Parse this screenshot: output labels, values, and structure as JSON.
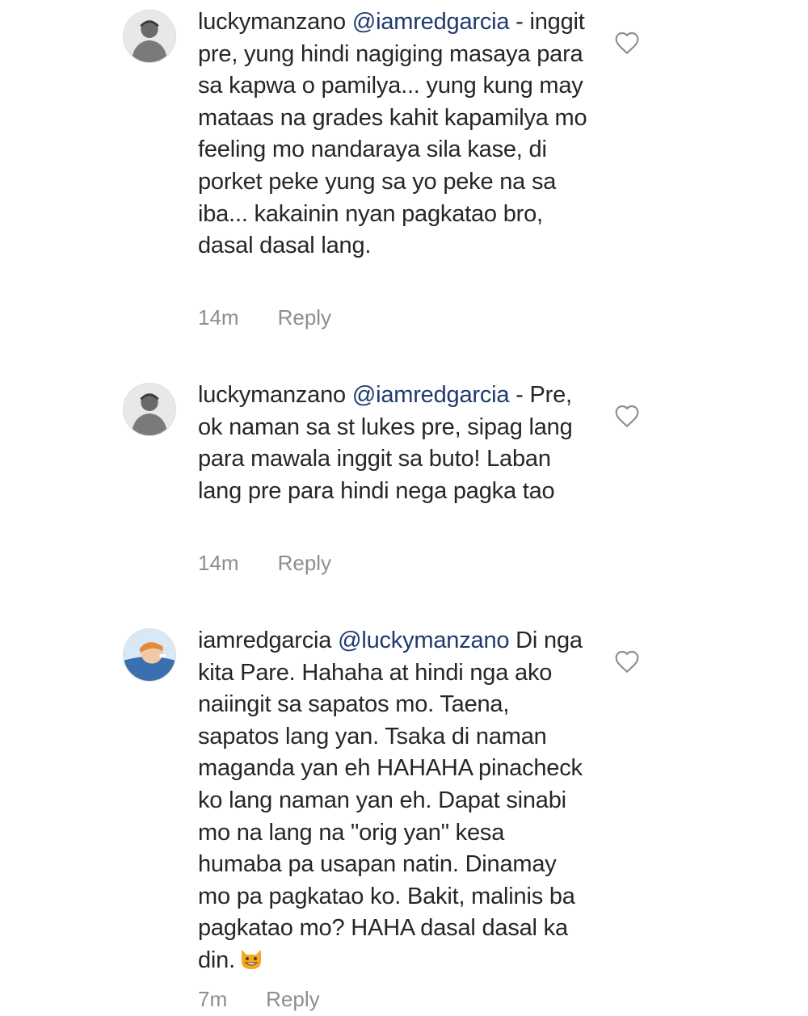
{
  "comments": [
    {
      "username": "luckymanzano",
      "mention": "@iamredgarcia",
      "text": " - inggit pre, yung hindi nagiging masaya para sa kapwa o pamilya... yung kung may mataas na grades kahit kapamilya mo feeling mo nandaraya sila kase, di porket peke yung sa yo peke na sa iba... kakainin nyan pagkatao bro, dasal dasal lang.",
      "time": "14m",
      "reply_label": "Reply",
      "avatar_icon": "user-avatar-icon"
    },
    {
      "username": "luckymanzano",
      "mention": "@iamredgarcia",
      "text": " - Pre, ok naman sa st lukes pre, sipag lang para mawala inggit sa buto! Laban lang pre para hindi nega pagka tao",
      "time": "14m",
      "reply_label": "Reply",
      "avatar_icon": "user-avatar-icon"
    },
    {
      "username": "iamredgarcia",
      "mention": "@luckymanzano",
      "text": " Di nga kita Pare. Hahaha at hindi nga ako naiingit sa sapatos mo. Taena, sapatos lang yan. Tsaka di naman maganda yan eh HAHAHA pinacheck ko lang naman yan eh. Dapat sinabi mo na lang na \"orig yan\" kesa humaba pa usapan natin. Dinamay mo pa pagkatao ko. Bakit, malinis ba pagkatao mo? HAHA dasal dasal ka din.",
      "time": "7m",
      "reply_label": "Reply",
      "avatar_icon": "user-avatar-icon",
      "emoji_icon": "grinning-cat-emoji-icon"
    }
  ],
  "colors": {
    "text": "#262626",
    "mention": "#1e3a6e",
    "meta": "#8e8e8e",
    "heart_stroke": "#8e8e8e"
  },
  "icons": {
    "like": "heart-outline-icon"
  }
}
